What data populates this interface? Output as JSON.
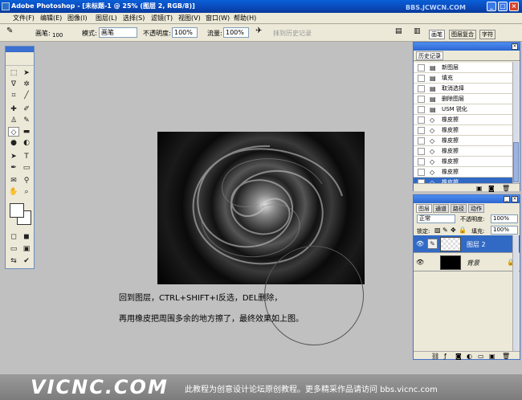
{
  "window": {
    "title": "Adobe Photoshop - [未标题-1 @ 25% (图层 2, RGB/8)]",
    "watermark": "BBS.JCWCN.COM"
  },
  "menu": [
    "文件(F)",
    "编辑(E)",
    "图像(I)",
    "图层(L)",
    "选择(S)",
    "滤镜(T)",
    "视图(V)",
    "窗口(W)",
    "帮助(H)"
  ],
  "options": {
    "brush_label": "画笔:",
    "brush_size": "100",
    "mode_label": "模式:",
    "mode_value": "画笔",
    "opacity_label": "不透明度:",
    "opacity_value": "100%",
    "flow_label": "流量:",
    "flow_value": "100%",
    "erase_history": "抹到历史记录"
  },
  "palette_well": [
    "画笔",
    "图层复合",
    "字符"
  ],
  "history": {
    "tab": "历史记录",
    "items": [
      {
        "label": "新图层",
        "icon": "doc-icon"
      },
      {
        "label": "填充",
        "icon": "doc-icon"
      },
      {
        "label": "取消选择",
        "icon": "doc-icon"
      },
      {
        "label": "删除图层",
        "icon": "doc-icon"
      },
      {
        "label": "USM 锐化",
        "icon": "doc-icon"
      },
      {
        "label": "橡皮擦",
        "icon": "eraser-icon"
      },
      {
        "label": "橡皮擦",
        "icon": "eraser-icon"
      },
      {
        "label": "橡皮擦",
        "icon": "eraser-icon"
      },
      {
        "label": "橡皮擦",
        "icon": "eraser-icon"
      },
      {
        "label": "橡皮擦",
        "icon": "eraser-icon"
      },
      {
        "label": "橡皮擦",
        "icon": "eraser-icon"
      },
      {
        "label": "橡皮擦",
        "icon": "eraser-icon"
      }
    ]
  },
  "layers": {
    "tabs": [
      "图层",
      "通道",
      "路径",
      "动作"
    ],
    "blend_mode": "正常",
    "opacity_label": "不透明度:",
    "opacity_value": "100%",
    "lock_label": "锁定:",
    "fill_label": "填充:",
    "fill_value": "100%",
    "items": [
      {
        "name": "图层 2"
      },
      {
        "name": "背景"
      }
    ]
  },
  "caption": {
    "line1": "回到图层，CTRL+SHIFT+I反选，DEL删除，",
    "line2": "再用橡皮把周围多余的地方擦了，最终效果如上图。"
  },
  "footer": {
    "brand": "VICNC.COM",
    "slogan": "此教程为创意设计论坛原创教程。更多精采作品请访问 bbs.vicnc.com"
  }
}
